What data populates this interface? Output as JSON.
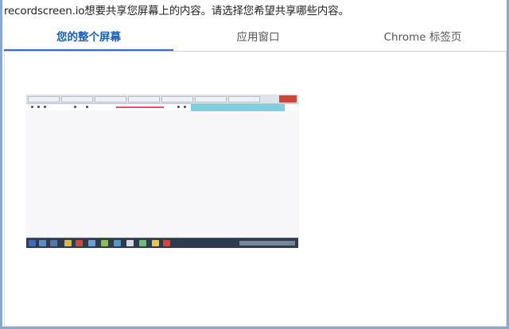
{
  "prompt": "recordscreen.io想要共享您屏幕上的内容。请选择您希望共享哪些内容。",
  "tabs": [
    {
      "label": "您的整个屏幕",
      "active": true
    },
    {
      "label": "应用窗口",
      "active": false
    },
    {
      "label": "Chrome 标签页",
      "active": false
    }
  ],
  "colors": {
    "accent": "#1a5fb4",
    "frame": "#8aa8cc"
  }
}
